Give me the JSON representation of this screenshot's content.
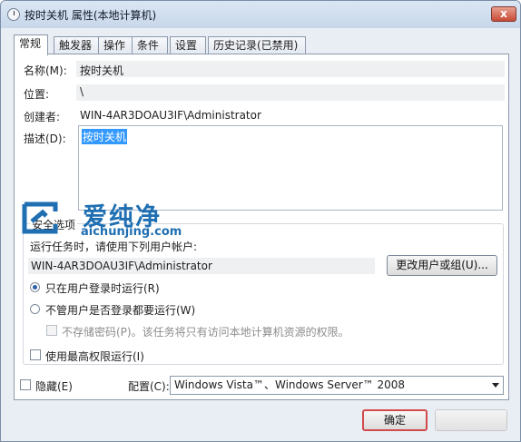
{
  "window": {
    "title": "按时关机 属性(本地计算机)",
    "close_label": "x"
  },
  "tabs": [
    {
      "label": "常规",
      "active": true
    },
    {
      "label": "触发器",
      "active": false
    },
    {
      "label": "操作",
      "active": false
    },
    {
      "label": "条件",
      "active": false
    },
    {
      "label": "设置",
      "active": false
    },
    {
      "label": "历史记录(已禁用)",
      "active": false
    }
  ],
  "general": {
    "name_label": "名称(M):",
    "name_value": "按时关机",
    "location_label": "位置:",
    "location_value": "\\",
    "author_label": "创建者:",
    "author_value": "WIN-4AR3DOAU3IF\\Administrator",
    "description_label": "描述(D):",
    "description_value": "按时关机"
  },
  "security": {
    "group_title": "安全选项",
    "run_as_label": "运行任务时，请使用下列用户帐户:",
    "user_account": "WIN-4AR3DOAU3IF\\Administrator",
    "change_user_button": "更改用户或组(U)...",
    "radio_logged_on": "只在用户登录时运行(R)",
    "radio_logged_on_selected": true,
    "radio_any": "不管用户是否登录都要运行(W)",
    "radio_any_selected": false,
    "no_store_password": "不存储密码(P)。该任务将只有访问本地计算机资源的权限。",
    "highest_privileges": "使用最高权限运行(I)"
  },
  "bottom": {
    "hidden_label": "隐藏(E)",
    "configure_label": "配置(C):",
    "configure_value": "Windows Vista™、Windows Server™ 2008",
    "ok_button": "确定"
  },
  "watermark": {
    "text": "爱纯净",
    "url": "aichunjing.com"
  },
  "colors": {
    "selection": "#3399ff",
    "accent": "#1f6fb2",
    "close": "#c74a36"
  }
}
